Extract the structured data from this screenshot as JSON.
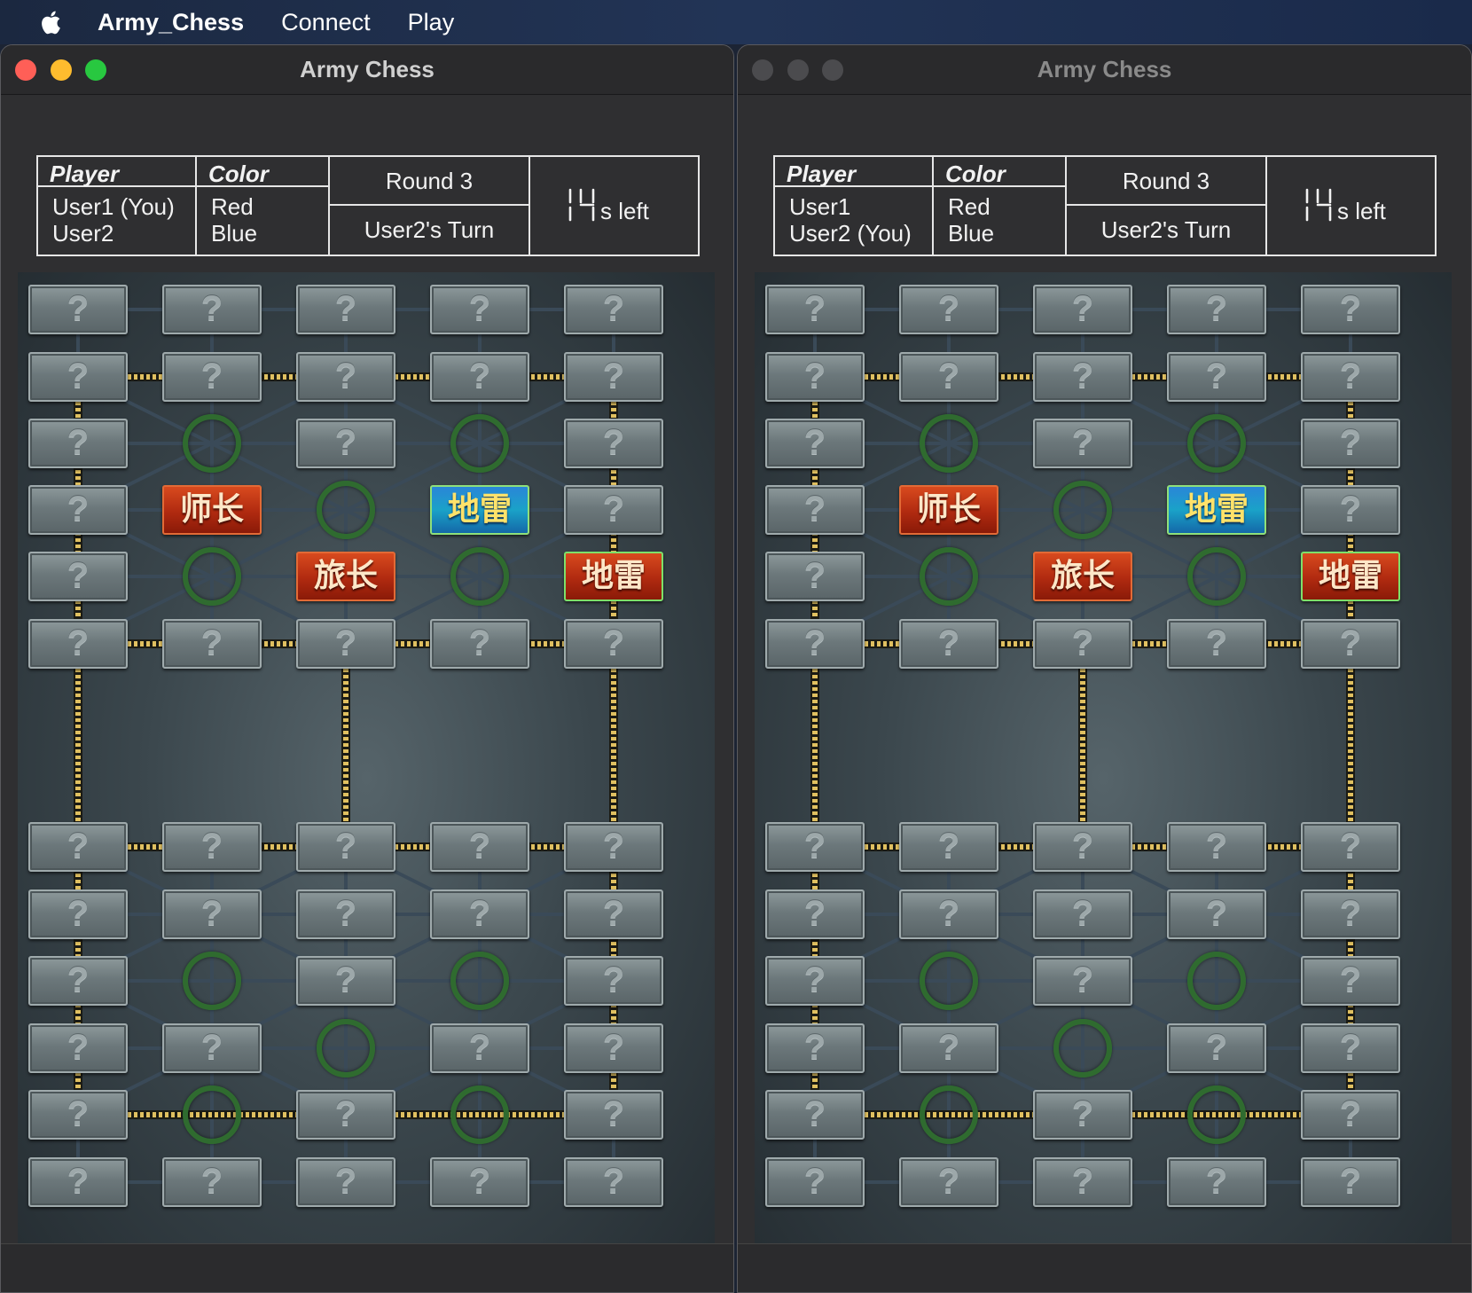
{
  "menubar": {
    "app_name": "Army_Chess",
    "menus": [
      "Connect",
      "Play"
    ]
  },
  "colors": {
    "close": "#ff5f57",
    "minimize": "#febc2e",
    "zoom": "#28c840",
    "inactive_traffic": "#4b4b4e",
    "title_active": "#d0d0d0",
    "title_inactive": "#8a8a8a",
    "red_piece": "#b02a10",
    "blue_piece": "#1a8ad0",
    "camp_ring": "#2f6b2f"
  },
  "windows": [
    {
      "title": "Army Chess",
      "active": true,
      "table": {
        "player_header": "Player",
        "color_header": "Color",
        "players": [
          "User1 (You)",
          "User2"
        ],
        "colors": [
          "Red",
          "Blue"
        ],
        "round": "Round 3",
        "turn": "User2's Turn",
        "timer_value": "14",
        "timer_suffix": "s left"
      }
    },
    {
      "title": "Army Chess",
      "active": false,
      "table": {
        "player_header": "Player",
        "color_header": "Color",
        "players": [
          "User1",
          "User2 (You)"
        ],
        "colors": [
          "Red",
          "Blue"
        ],
        "round": "Round 3",
        "turn": "User2's Turn",
        "timer_value": "14",
        "timer_suffix": "s left"
      }
    }
  ],
  "board": {
    "columns": 5,
    "rows": 12,
    "hidden_symbol": "?",
    "camps": [
      [
        2,
        1
      ],
      [
        2,
        3
      ],
      [
        3,
        2
      ],
      [
        4,
        1
      ],
      [
        4,
        3
      ],
      [
        8,
        1
      ],
      [
        8,
        3
      ],
      [
        9,
        2
      ],
      [
        10,
        1
      ],
      [
        10,
        3
      ]
    ],
    "revealed": [
      {
        "row": 3,
        "col": 1,
        "label": "师长",
        "side": "red"
      },
      {
        "row": 3,
        "col": 3,
        "label": "地雷",
        "side": "blue"
      },
      {
        "row": 4,
        "col": 2,
        "label": "旅长",
        "side": "red"
      },
      {
        "row": 4,
        "col": 4,
        "label": "地雷",
        "side": "red-glow"
      }
    ]
  }
}
